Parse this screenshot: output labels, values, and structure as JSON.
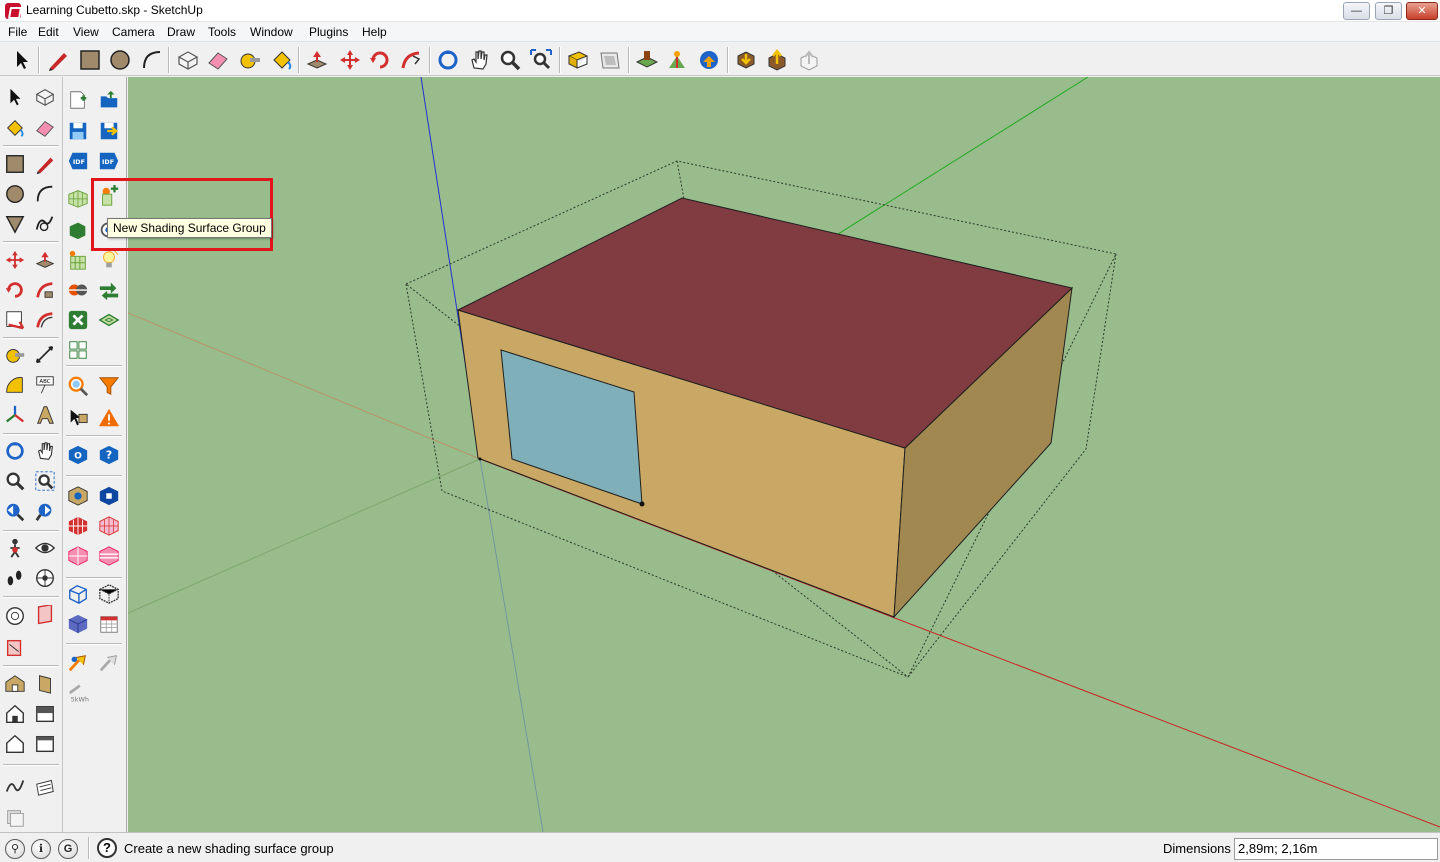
{
  "window": {
    "title": "Learning Cubetto.skp - SketchUp",
    "min_glyph": "—",
    "max_glyph": "❐",
    "close_glyph": "✕"
  },
  "menu": [
    "File",
    "Edit",
    "View",
    "Camera",
    "Draw",
    "Tools",
    "Window",
    "Plugins",
    "Help"
  ],
  "tooltip": "New Shading Surface Group",
  "status": {
    "left_icons": [
      "geo-location-icon",
      "credits-icon",
      "user-account-icon"
    ],
    "help_glyph": "?",
    "text": "Create a new shading surface group",
    "dimensions_label": "Dimensions",
    "dimensions_value": "2,89m; 2,16m"
  },
  "colors": {
    "sky_ground": "#98bc8c",
    "roof": "#803c40",
    "wall_front": "#c8a864",
    "wall_side": "#a08850",
    "window_glass": "#7fafb8",
    "highlight": "#e0161c",
    "tooltip_bg": "#ffffe1"
  }
}
